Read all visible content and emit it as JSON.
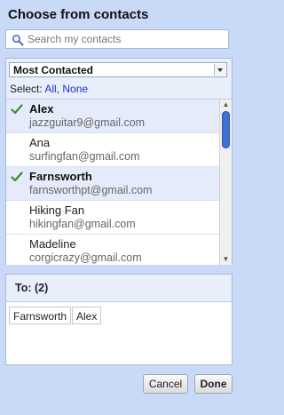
{
  "dialog": {
    "title": "Choose from contacts"
  },
  "search": {
    "placeholder": "Search my contacts",
    "value": "",
    "icon": "search-icon"
  },
  "group_selector": {
    "selected": "Most Contacted"
  },
  "select": {
    "label": "Select:",
    "all": "All",
    "separator": ",",
    "none": "None"
  },
  "contacts": [
    {
      "name": "Alex",
      "email": "jazzguitar9@gmail.com",
      "selected": true
    },
    {
      "name": "Ana",
      "email": "surfingfan@gmail.com",
      "selected": false
    },
    {
      "name": "Farnsworth",
      "email": "farnsworthpt@gmail.com",
      "selected": true
    },
    {
      "name": "Hiking Fan",
      "email": "hikingfan@gmail.com",
      "selected": false
    },
    {
      "name": "Madeline",
      "email": "corgicrazy@gmail.com",
      "selected": false
    }
  ],
  "to": {
    "label": "To: (2)",
    "recipients": [
      "Farnsworth",
      "Alex"
    ]
  },
  "buttons": {
    "cancel": "Cancel",
    "done": "Done"
  },
  "colors": {
    "background": "#c9daf8",
    "link": "#1a33c9",
    "check": "#3b8c2a",
    "scroll_thumb": "#3f6fd0"
  }
}
